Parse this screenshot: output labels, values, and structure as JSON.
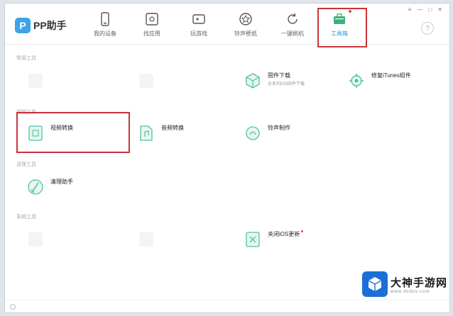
{
  "app": {
    "logo_text": "PP助手",
    "logo_mark": "P"
  },
  "window_controls": {
    "menu": "≡",
    "minimize": "—",
    "maximize": "□",
    "close": "✕"
  },
  "help_icon": "?",
  "nav": [
    {
      "label": "我的设备",
      "icon": "phone-icon"
    },
    {
      "label": "找应用",
      "icon": "app-store-icon"
    },
    {
      "label": "玩游戏",
      "icon": "game-icon"
    },
    {
      "label": "铃声壁纸",
      "icon": "ringtone-icon"
    },
    {
      "label": "一键刷机",
      "icon": "flash-icon"
    },
    {
      "label": "工具箱",
      "icon": "toolbox-icon",
      "active": true,
      "badge": true
    }
  ],
  "sections": {
    "s1": "常用工具",
    "s2": "视频工具",
    "s3": "清理工具",
    "s4": "系统工具"
  },
  "tools": {
    "t1": {
      "name": "",
      "desc": ""
    },
    "t2": {
      "name": "",
      "desc": ""
    },
    "t3": {
      "name": "固件下载",
      "desc": "全系列iOS固件下载"
    },
    "t4": {
      "name": "修复iTunes组件",
      "desc": ""
    },
    "t5": {
      "name": "视频转换",
      "desc": ""
    },
    "t6": {
      "name": "音频转换",
      "desc": ""
    },
    "t7": {
      "name": "铃声制作",
      "desc": ""
    },
    "t8": {
      "name": "清理助手",
      "desc": ""
    },
    "t9": {
      "name": "",
      "desc": ""
    },
    "t10": {
      "name": "",
      "desc": ""
    },
    "t11": {
      "name": "关闭iOS更新",
      "desc": ""
    }
  },
  "footer": {
    "label": ""
  },
  "watermark": {
    "name": "大神手游网",
    "url": "www.dsdsv.com"
  },
  "colors": {
    "accent": "#2e9bd8",
    "highlight": "#c9333a",
    "brand_logo": "#3aa5e8",
    "icon_green": "#4fc3a0"
  }
}
